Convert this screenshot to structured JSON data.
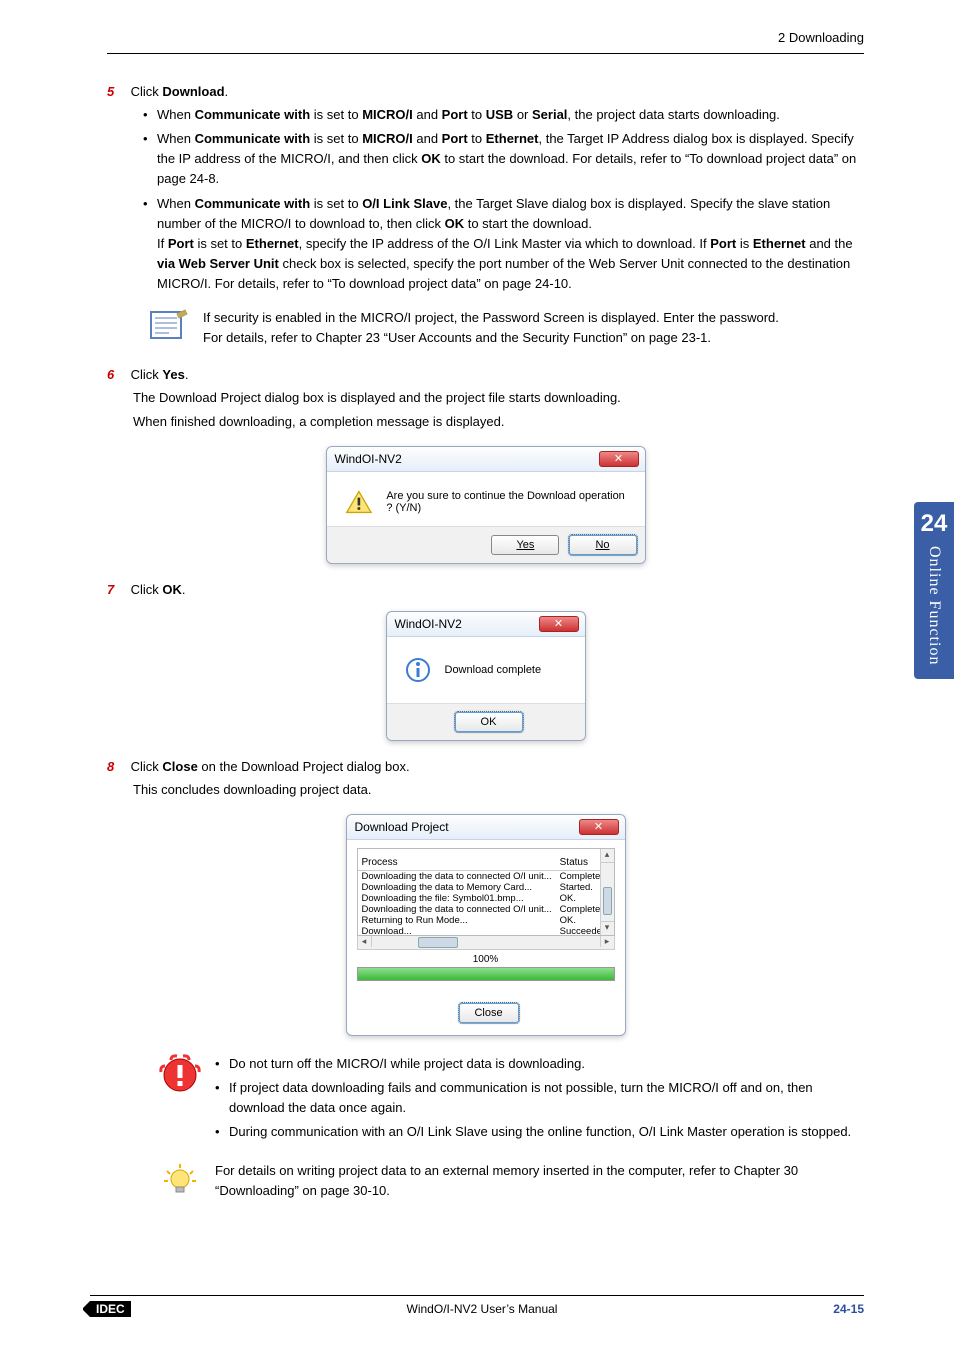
{
  "header": {
    "breadcrumb": "2 Downloading"
  },
  "sidetab": {
    "chapter_num": "24",
    "chapter_label": "Online Function"
  },
  "steps": {
    "s5": {
      "num": "5",
      "text_pre": "Click ",
      "text_bold": "Download",
      "text_post": ".",
      "b1_parts": [
        "When ",
        "Communicate with",
        " is set to ",
        "MICRO/I",
        " and ",
        "Port",
        " to ",
        "USB",
        " or ",
        "Serial",
        ", the project data starts downloading."
      ],
      "b2_parts": [
        "When ",
        "Communicate with",
        " is set to ",
        "MICRO/I",
        " and ",
        "Port",
        " to ",
        "Ethernet",
        ", the Target IP Address dialog box is displayed. Specify the IP address of the MICRO/I, and then click ",
        "OK",
        " to start the download. For details, refer to “To download project data” on page 24-8."
      ],
      "b3_parts": [
        "When ",
        "Communicate with",
        " is set to ",
        "O/I Link Slave",
        ", the Target Slave dialog box is displayed. Specify the slave station number of the MICRO/I to download to, then click ",
        "OK",
        " to start the download."
      ],
      "b3_sub_parts": [
        "If ",
        "Port",
        " is set to ",
        "Ethernet",
        ", specify the IP address of the O/I Link Master via which to download. If ",
        "Port",
        " is ",
        "Ethernet",
        " and the ",
        "via Web Server Unit",
        " check box is selected, specify the port number of the Web Server Unit connected to the destination MICRO/I. For details, refer to “To download project data” on page 24-10."
      ]
    },
    "note1": {
      "line1": "If security is enabled in the MICRO/I project, the Password Screen is displayed. Enter the password.",
      "line2": "For details, refer to Chapter 23 “User Accounts and the Security Function” on page 23-1."
    },
    "s6": {
      "num": "6",
      "text_pre": "Click ",
      "text_bold": "Yes",
      "text_post": ".",
      "p1": "The Download Project dialog box is displayed and the project file starts downloading.",
      "p2": "When finished downloading, a completion message is displayed."
    },
    "s7": {
      "num": "7",
      "text_pre": "Click ",
      "text_bold": "OK",
      "text_post": "."
    },
    "s8": {
      "num": "8",
      "text_pre": "Click ",
      "text_bold": "Close",
      "text_post": " on the Download Project dialog box.",
      "p1": "This concludes downloading project data."
    },
    "warn": {
      "b1": "Do not turn off the MICRO/I while project data is downloading.",
      "b2": "If project data downloading fails and communication is not possible, turn the MICRO/I off and on, then download the data once again.",
      "b3": "During communication with an O/I Link Slave using the online function, O/I Link Master operation is stopped."
    },
    "tip": {
      "text": "For details on writing project data to an external memory inserted in the computer, refer to Chapter 30 “Downloading” on page 30-10."
    }
  },
  "dlg1": {
    "title": "WindOI-NV2",
    "msg": "Are you sure to continue the Download operation ? (Y/N)",
    "yes": "Yes",
    "no": "No"
  },
  "dlg2": {
    "title": "WindOI-NV2",
    "msg": "Download complete",
    "ok": "OK"
  },
  "dlg3": {
    "title": "Download Project",
    "col_process": "Process",
    "col_status": "Status",
    "rows": [
      {
        "p": "Downloading the data to connected O/I unit...",
        "s": "Complete."
      },
      {
        "p": "Downloading the data to Memory Card...",
        "s": "Started."
      },
      {
        "p": "Downloading the file: Symbol01.bmp...",
        "s": "OK."
      },
      {
        "p": "Downloading the data to connected O/I unit...",
        "s": "Complete."
      },
      {
        "p": "Returning to Run Mode...",
        "s": "OK."
      },
      {
        "p": "Download...",
        "s": "Succeeded."
      }
    ],
    "pct": "100%",
    "close": "Close"
  },
  "footer": {
    "logo": "IDEC",
    "center": "WindO/I-NV2 User’s Manual",
    "page": "24-15"
  }
}
